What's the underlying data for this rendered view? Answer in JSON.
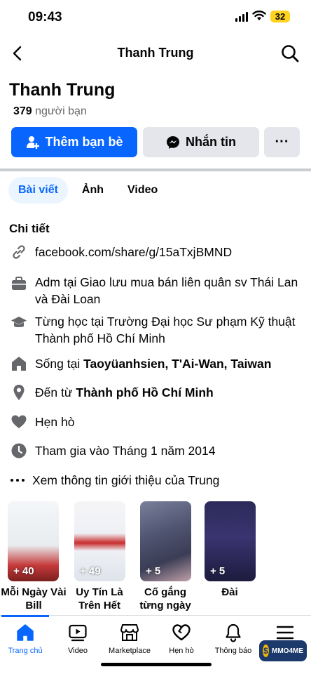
{
  "status_bar": {
    "time": "09:43",
    "battery": "32"
  },
  "header": {
    "title": "Thanh Trung"
  },
  "profile": {
    "name": "Thanh Trung",
    "friends_count": "379",
    "friends_label": "người bạn"
  },
  "actions": {
    "add_friend": "Thêm bạn bè",
    "message": "Nhắn tin",
    "more": "···"
  },
  "tabs": [
    {
      "label": "Bài viết",
      "active": true
    },
    {
      "label": "Ảnh",
      "active": false
    },
    {
      "label": "Video",
      "active": false
    }
  ],
  "details": {
    "title": "Chi tiết",
    "link": "facebook.com/share/g/15aTxjBMND",
    "work": "Adm tại Giao lưu mua bán liên quân sv Thái Lan và Đài Loan",
    "education": "Từng học tại Trường Đại học Sư phạm Kỹ thuật Thành phố Hồ Chí Minh",
    "lives_prefix": "Sống tại ",
    "lives_place": "Taoyüanhsien, T'Ai-Wan, Taiwan",
    "from_prefix": "Đến từ ",
    "from_place": "Thành phố Hồ Chí Minh",
    "relationship": "Hẹn hò",
    "joined": "Tham gia vào Tháng 1 năm 2014",
    "see_more": "Xem thông tin giới thiệu của Trung"
  },
  "featured": [
    {
      "count": "+ 40",
      "label": "Mỗi Ngày Vài Bill"
    },
    {
      "count": "+ 49",
      "label": "Uy Tín Là Trên Hết"
    },
    {
      "count": "+ 5",
      "label": "Cố gắng từng ngày"
    },
    {
      "count": "+ 5",
      "label": "Đài"
    }
  ],
  "bottom_nav": [
    {
      "label": "Trang chủ",
      "icon": "home-icon",
      "active": true
    },
    {
      "label": "Video",
      "icon": "video-icon",
      "active": false
    },
    {
      "label": "Marketplace",
      "icon": "marketplace-icon",
      "active": false
    },
    {
      "label": "Hẹn hò",
      "icon": "dating-icon",
      "active": false
    },
    {
      "label": "Thông báo",
      "icon": "bell-icon",
      "active": false
    },
    {
      "label": "",
      "icon": "menu-icon",
      "active": false
    }
  ],
  "watermark": {
    "text": "MMO4ME"
  },
  "colors": {
    "accent": "#0866ff",
    "button_gray": "#e4e6eb",
    "active_tab_bg": "#ebf5ff"
  }
}
